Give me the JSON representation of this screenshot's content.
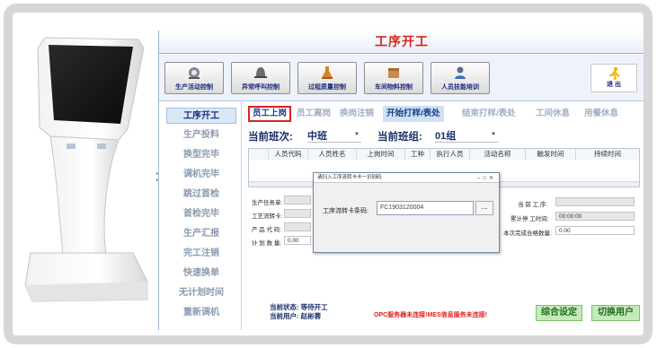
{
  "window": {
    "title": "工序开工"
  },
  "toolbar": {
    "buttons": [
      {
        "label": "生产活动控制",
        "icon": "gear-robot-icon"
      },
      {
        "label": "异常呼叫控制",
        "icon": "alarm-bell-icon"
      },
      {
        "label": "过程质量控制",
        "icon": "flask-icon"
      },
      {
        "label": "车间物料控制",
        "icon": "box-icon"
      },
      {
        "label": "人员技能培训",
        "icon": "worker-icon"
      }
    ],
    "exit_label": "退 出"
  },
  "sidebar": {
    "items": [
      {
        "label": "工序开工",
        "active": true
      },
      {
        "label": "生产投料"
      },
      {
        "label": "换型完毕"
      },
      {
        "label": "调机完毕"
      },
      {
        "label": "跳过首检"
      },
      {
        "label": "首检完毕"
      },
      {
        "label": "生产汇报"
      },
      {
        "label": "完工注销"
      },
      {
        "label": "快速换单"
      },
      {
        "label": "无计划时间"
      },
      {
        "label": "重新调机"
      }
    ]
  },
  "tabs": [
    {
      "label": "员工上岗",
      "state": "active"
    },
    {
      "label": "员工离岗"
    },
    {
      "label": "换岗注销"
    },
    {
      "label": "开始打样/表处",
      "state": "highlight"
    },
    {
      "label": "结束打样/表处"
    },
    {
      "label": "工间休息"
    },
    {
      "label": "用餐休息"
    }
  ],
  "shift": {
    "shift_label": "当前班次:",
    "shift_value": "中班",
    "group_label": "当前班组:",
    "group_value": "01组"
  },
  "grid": {
    "columns": [
      "人员代码",
      "人员姓名",
      "上岗时间",
      "工种",
      "执行人员",
      "活动名称",
      "触发时间",
      "持续时间"
    ]
  },
  "form": {
    "task_label": "生产任务单:",
    "flow_card_label": "工艺流转卡:",
    "product_code_label": "产 品 代 码:",
    "plan_qty_label": "计 划 数 量:",
    "plan_qty_value": "0.00",
    "current_process_label": "当 前 工 序:",
    "cumulative_time_label": "累计停 工时间:",
    "cumulative_time_value": "00:00:00",
    "pass_qty_label": "本次完成合格数量:",
    "pass_qty_value": "0.00"
  },
  "status": {
    "state_label": "当前状态: 等待开工",
    "user_label": "当前用户: 赵彬蓉",
    "connection_warning": "OPC服务器未连接!MES信息服务未连接!"
  },
  "buttons": {
    "settings": "综合设定",
    "switch_user": "切换用户"
  },
  "dialog": {
    "title": "请扫入工序流转卡卡一识别码",
    "field_label": "工序流转卡条码:",
    "field_value": "FC1903120004",
    "browse_label": "..."
  },
  "colors": {
    "title_red": "#d9261c",
    "accent_blue": "#1a3d8f",
    "button_green": "#c4eab8",
    "warning_red": "#e02020"
  }
}
